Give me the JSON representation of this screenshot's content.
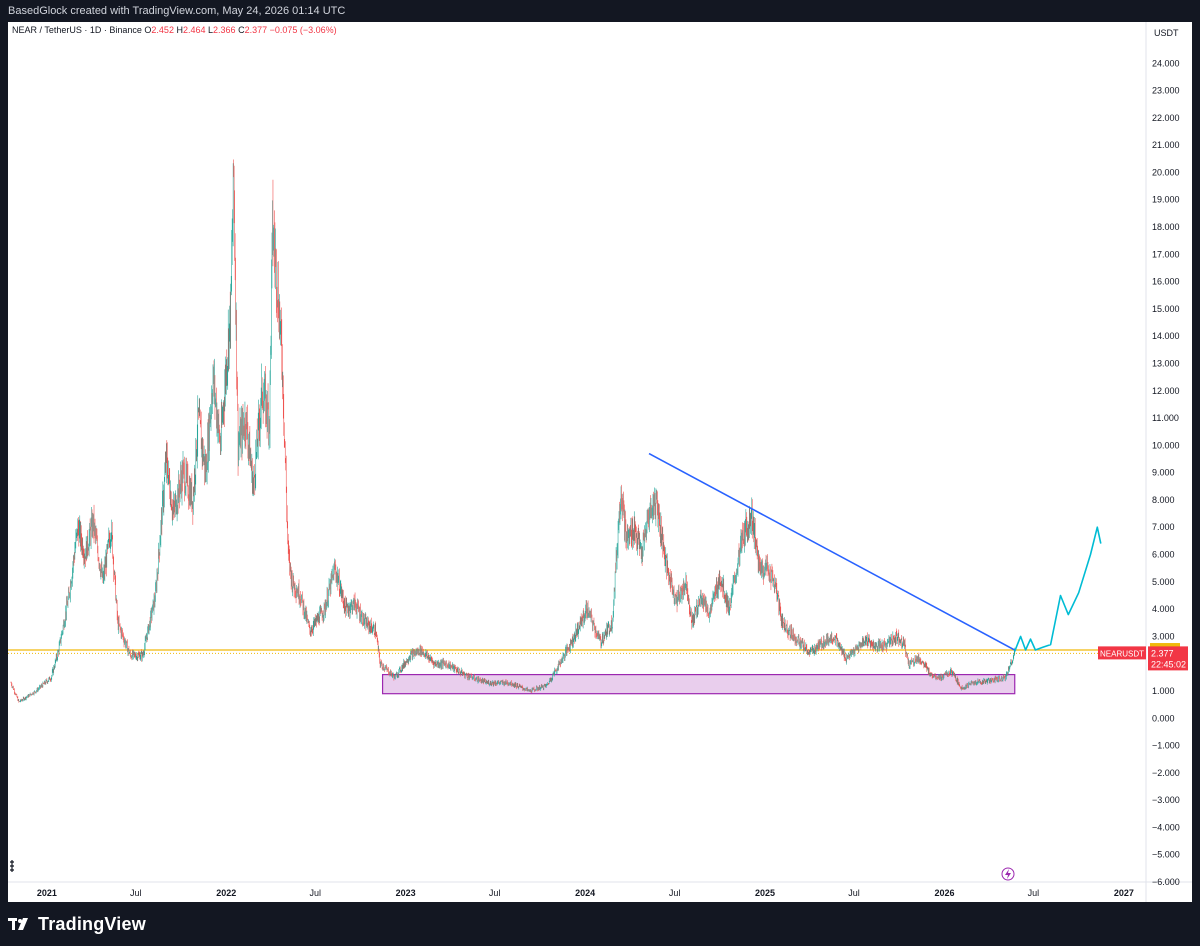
{
  "header": {
    "caption": "BasedGlock created with TradingView.com, May 24, 2026 01:14 UTC"
  },
  "legend": {
    "symbol": "NEAR / TetherUS · 1D · Binance",
    "o_label": "O",
    "o_value": "2.452",
    "h_label": "H",
    "h_value": "2.464",
    "l_label": "L",
    "l_value": "2.366",
    "c_label": "C",
    "c_value": "2.377",
    "change": "−0.075 (−3.06%)"
  },
  "price_scale": {
    "unit": "USDT",
    "ticks": [
      "24.000",
      "23.000",
      "22.000",
      "21.000",
      "20.000",
      "19.000",
      "18.000",
      "17.000",
      "16.000",
      "15.000",
      "14.000",
      "13.000",
      "12.000",
      "11.000",
      "10.000",
      "9.000",
      "8.000",
      "7.000",
      "6.000",
      "5.000",
      "4.000",
      "3.000",
      "2.000",
      "1.000",
      "0.000",
      "−1.000",
      "−2.000",
      "−3.000",
      "−4.000",
      "−5.000",
      "−6.000"
    ],
    "level_tag": "2.500",
    "symbol_tag": "NEARUSDT",
    "price_tag": "2.377",
    "countdown_tag": "22:45:02"
  },
  "time_axis": {
    "labels": [
      "2021",
      "Jul",
      "2022",
      "Jul",
      "2023",
      "Jul",
      "2024",
      "Jul",
      "2025",
      "Jul",
      "2026",
      "Jul",
      "2027"
    ],
    "bold": [
      "2021",
      "2022",
      "2023",
      "2024",
      "2025",
      "2026",
      "2027"
    ]
  },
  "footer": {
    "brand": "TradingView"
  },
  "colors": {
    "up": "#26a69a",
    "down": "#ef5350",
    "level": "#f0b90b",
    "trendline": "#2962ff",
    "projection": "#00bcd4",
    "box_fill": "#e1bee7",
    "box_border": "#9c27b0",
    "last_price": "#f23645"
  },
  "chart_data": {
    "type": "candlestick",
    "symbol": "NEAR / TetherUS",
    "timeframe": "1D",
    "exchange": "Binance",
    "ylim": [
      -6,
      25
    ],
    "x_range": [
      "2020-10-14",
      "2027-02-15"
    ],
    "ohlc_last": {
      "open": 2.452,
      "high": 2.464,
      "low": 2.366,
      "close": 2.377
    },
    "price_path": [
      [
        "2020-10-20",
        1.3
      ],
      [
        "2020-11-05",
        0.6
      ],
      [
        "2020-12-10",
        1.0
      ],
      [
        "2021-01-10",
        1.5
      ],
      [
        "2021-01-25",
        2.5
      ],
      [
        "2021-02-15",
        4.5
      ],
      [
        "2021-03-05",
        7.0
      ],
      [
        "2021-03-20",
        6.0
      ],
      [
        "2021-04-05",
        7.2
      ],
      [
        "2021-04-25",
        5.0
      ],
      [
        "2021-05-12",
        7.0
      ],
      [
        "2021-05-25",
        3.5
      ],
      [
        "2021-06-20",
        2.3
      ],
      [
        "2021-07-15",
        2.3
      ],
      [
        "2021-08-10",
        4.5
      ],
      [
        "2021-09-01",
        9.5
      ],
      [
        "2021-09-15",
        7.5
      ],
      [
        "2021-10-05",
        9.0
      ],
      [
        "2021-10-25",
        8.0
      ],
      [
        "2021-11-05",
        11.0
      ],
      [
        "2021-11-20",
        9.0
      ],
      [
        "2021-12-05",
        12.5
      ],
      [
        "2021-12-20",
        10.0
      ],
      [
        "2022-01-10",
        15.0
      ],
      [
        "2022-01-16",
        20.0
      ],
      [
        "2022-01-25",
        10.0
      ],
      [
        "2022-02-10",
        11.0
      ],
      [
        "2022-02-25",
        8.5
      ],
      [
        "2022-03-15",
        12.0
      ],
      [
        "2022-03-30",
        11.0
      ],
      [
        "2022-04-05",
        18.0
      ],
      [
        "2022-04-15",
        16.0
      ],
      [
        "2022-04-25",
        13.0
      ],
      [
        "2022-05-07",
        6.0
      ],
      [
        "2022-05-15",
        5.0
      ],
      [
        "2022-06-01",
        4.5
      ],
      [
        "2022-06-20",
        3.2
      ],
      [
        "2022-07-20",
        4.0
      ],
      [
        "2022-08-10",
        5.5
      ],
      [
        "2022-09-01",
        4.0
      ],
      [
        "2022-09-20",
        4.2
      ],
      [
        "2022-10-10",
        3.5
      ],
      [
        "2022-11-01",
        3.2
      ],
      [
        "2022-11-10",
        2.0
      ],
      [
        "2022-12-10",
        1.5
      ],
      [
        "2023-01-10",
        2.3
      ],
      [
        "2023-02-01",
        2.5
      ],
      [
        "2023-03-01",
        2.0
      ],
      [
        "2023-03-25",
        2.0
      ],
      [
        "2023-05-01",
        1.6
      ],
      [
        "2023-06-15",
        1.3
      ],
      [
        "2023-08-01",
        1.3
      ],
      [
        "2023-09-10",
        1.0
      ],
      [
        "2023-10-15",
        1.2
      ],
      [
        "2023-11-10",
        2.0
      ],
      [
        "2023-12-10",
        3.0
      ],
      [
        "2024-01-05",
        4.0
      ],
      [
        "2024-02-01",
        2.8
      ],
      [
        "2024-02-25",
        3.5
      ],
      [
        "2024-03-14",
        8.5
      ],
      [
        "2024-03-25",
        6.5
      ],
      [
        "2024-04-10",
        7.0
      ],
      [
        "2024-04-25",
        6.0
      ],
      [
        "2024-05-10",
        7.5
      ],
      [
        "2024-05-25",
        8.0
      ],
      [
        "2024-06-15",
        5.5
      ],
      [
        "2024-07-05",
        4.3
      ],
      [
        "2024-07-25",
        5.0
      ],
      [
        "2024-08-05",
        3.5
      ],
      [
        "2024-08-25",
        4.5
      ],
      [
        "2024-09-10",
        3.8
      ],
      [
        "2024-10-01",
        5.2
      ],
      [
        "2024-10-20",
        4.0
      ],
      [
        "2024-11-15",
        6.5
      ],
      [
        "2024-12-05",
        7.5
      ],
      [
        "2024-12-20",
        5.5
      ],
      [
        "2025-01-06",
        5.5
      ],
      [
        "2025-01-20",
        5.0
      ],
      [
        "2025-02-05",
        3.5
      ],
      [
        "2025-03-01",
        3.0
      ],
      [
        "2025-04-01",
        2.4
      ],
      [
        "2025-05-01",
        2.8
      ],
      [
        "2025-05-20",
        3.0
      ],
      [
        "2025-06-15",
        2.2
      ],
      [
        "2025-07-10",
        2.6
      ],
      [
        "2025-07-25",
        2.9
      ],
      [
        "2025-08-15",
        2.6
      ],
      [
        "2025-09-05",
        2.7
      ],
      [
        "2025-09-25",
        3.0
      ],
      [
        "2025-10-10",
        2.8
      ],
      [
        "2025-10-20",
        2.0
      ],
      [
        "2025-11-10",
        2.2
      ],
      [
        "2025-12-05",
        1.6
      ],
      [
        "2025-12-25",
        1.5
      ],
      [
        "2026-01-15",
        1.7
      ],
      [
        "2026-02-05",
        1.1
      ],
      [
        "2026-03-01",
        1.3
      ],
      [
        "2026-04-10",
        1.4
      ],
      [
        "2026-05-05",
        1.5
      ],
      [
        "2026-05-24",
        2.377
      ]
    ],
    "horizontal_level": {
      "price": 2.5,
      "label": "2.500"
    },
    "support_box": {
      "from": "2022-11-15",
      "to": "2026-05-24",
      "low": 0.9,
      "high": 1.6
    },
    "trendline": [
      [
        "2024-05-10",
        9.7
      ],
      [
        "2026-05-24",
        2.5
      ]
    ],
    "projection_path": [
      [
        "2026-05-24",
        2.45
      ],
      [
        "2026-06-05",
        3.0
      ],
      [
        "2026-06-15",
        2.5
      ],
      [
        "2026-06-25",
        2.9
      ],
      [
        "2026-07-05",
        2.5
      ],
      [
        "2026-07-20",
        2.6
      ],
      [
        "2026-08-05",
        2.7
      ],
      [
        "2026-08-25",
        4.5
      ],
      [
        "2026-09-10",
        3.8
      ],
      [
        "2026-10-01",
        4.6
      ],
      [
        "2026-10-25",
        6.0
      ],
      [
        "2026-11-08",
        7.0
      ],
      [
        "2026-11-15",
        6.4
      ]
    ],
    "last_price": 2.377
  }
}
